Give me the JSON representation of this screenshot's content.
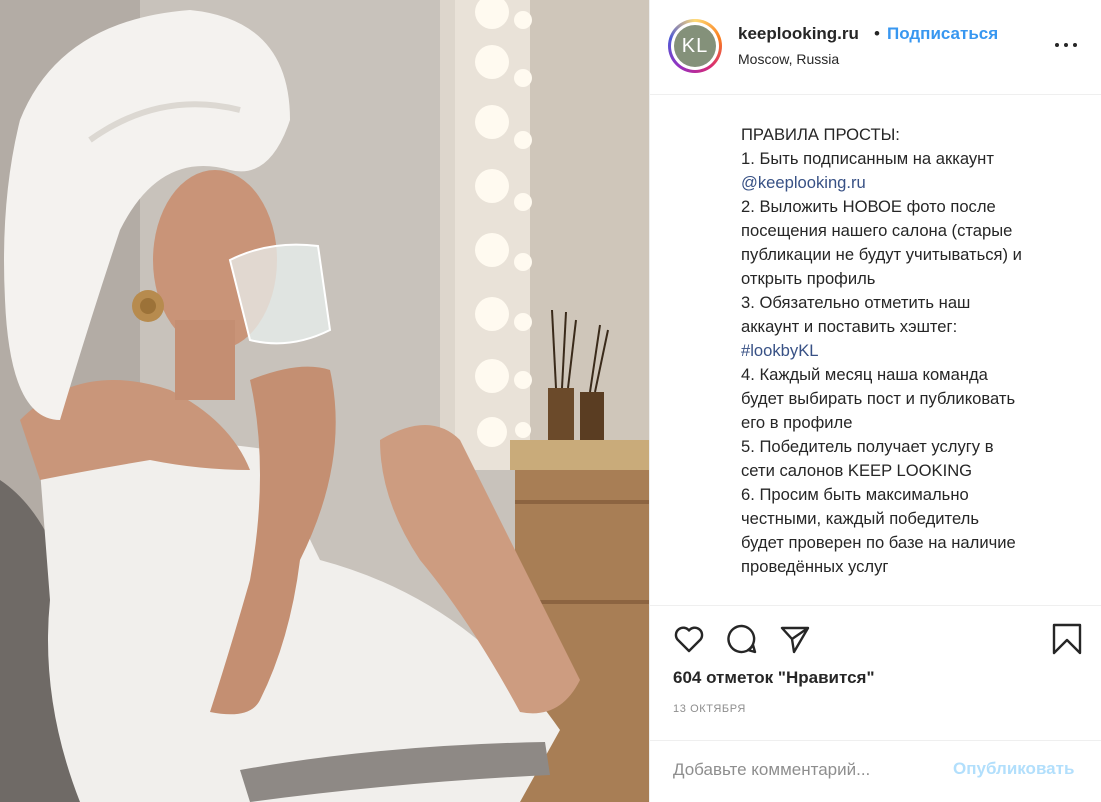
{
  "post": {
    "photo_description_icon": "photo-icon"
  },
  "header": {
    "avatar_initials": "KL",
    "username": "keeplooking.ru",
    "separator": "•",
    "follow_label": "Подписаться",
    "location": "Moscow, Russia",
    "more_icon": "more-options-icon"
  },
  "caption": {
    "lines": [
      {
        "text": "ПРАВИЛА ПРОСТЫ:",
        "link": false
      },
      {
        "text": "1. Быть подписанным на аккаунт",
        "link": false
      },
      {
        "text": "@keeplooking.ru",
        "link": true
      },
      {
        "text": "2. Выложить НОВОЕ фото после",
        "link": false
      },
      {
        "text": "посещения нашего салона (старые",
        "link": false
      },
      {
        "text": "публикации не будут учитываться) и",
        "link": false
      },
      {
        "text": "открыть профиль",
        "link": false
      },
      {
        "text": "3. Обязательно отметить наш",
        "link": false
      },
      {
        "text": "аккаунт и поставить хэштег:",
        "link": false
      },
      {
        "text": "#lookbyKL",
        "link": true
      },
      {
        "text": "4. Каждый месяц наша команда",
        "link": false
      },
      {
        "text": "будет выбирать пост и публиковать",
        "link": false
      },
      {
        "text": "его в профиле",
        "link": false
      },
      {
        "text": "5. Победитель получает услугу в",
        "link": false
      },
      {
        "text": "сети салонов KEEP LOOKING",
        "link": false
      },
      {
        "text": "6. Просим быть максимально",
        "link": false
      },
      {
        "text": "честными, каждый победитель",
        "link": false
      },
      {
        "text": "будет проверен по базе на наличие",
        "link": false
      },
      {
        "text": "проведённых услуг",
        "link": false
      }
    ]
  },
  "actions": {
    "like_icon": "heart-icon",
    "comment_icon": "comment-icon",
    "share_icon": "share-icon",
    "save_icon": "bookmark-icon",
    "likes_text": "604 отметок \"Нравится\"",
    "date_text": "13 ОКТЯБРЯ"
  },
  "comment": {
    "placeholder": "Добавьте комментарий...",
    "publish_label": "Опубликовать"
  },
  "colors": {
    "accent": "#3897f0",
    "publish_disabled": "#b2dffc",
    "link": "#385185",
    "text": "#262626",
    "muted": "#8e8e8e"
  }
}
